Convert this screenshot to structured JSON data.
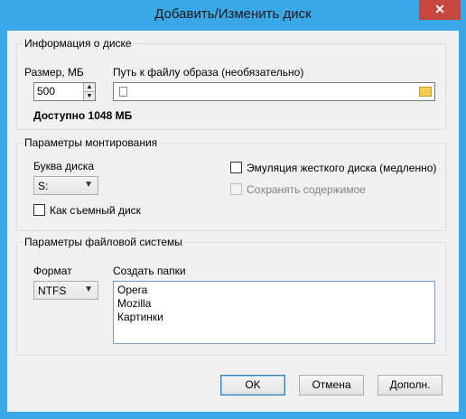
{
  "window": {
    "title": "Добавить/Изменить диск",
    "close_glyph": "✕"
  },
  "disk_info": {
    "legend": "Информация о диске",
    "size_label": "Размер, МБ",
    "size_value": "500",
    "path_label": "Путь к файлу образа (необязательно)",
    "path_value": "",
    "available": "Доступно 1048 МБ"
  },
  "mount": {
    "legend": "Параметры монтирования",
    "drive_letter_label": "Буква диска",
    "drive_letter_value": "S:",
    "removable_label": "Как съемный диск",
    "removable_checked": false,
    "hdd_emulation_label": "Эмуляция жесткого диска (медленно)",
    "hdd_emulation_checked": false,
    "save_contents_label": "Сохранять содержимое",
    "save_contents_checked": false,
    "save_contents_disabled": true
  },
  "filesystem": {
    "legend": "Параметры файловой системы",
    "format_label": "Формат",
    "format_value": "NTFS",
    "folders_label": "Создать папки",
    "folders": [
      "Opera",
      "Mozilla",
      "Картинки"
    ]
  },
  "buttons": {
    "ok": "OK",
    "cancel": "Отмена",
    "more": "Дополн."
  }
}
